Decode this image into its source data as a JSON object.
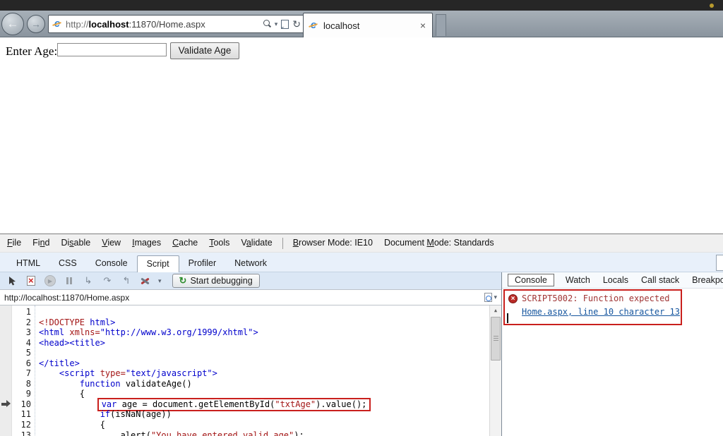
{
  "browser": {
    "address": {
      "scheme": "http://",
      "host": "localhost",
      "path": ":11870/Home.aspx"
    },
    "tab_title": "localhost",
    "tab_close": "×",
    "icons": {
      "back": "←",
      "forward": "→",
      "ie_logo": "e",
      "autocomplete_caret": "▾",
      "refresh": "↻",
      "tab_close": "×"
    }
  },
  "page": {
    "label": "Enter Age:",
    "input_value": "",
    "button": "Validate Age"
  },
  "devtools": {
    "menu": [
      {
        "label": "File",
        "u": 0
      },
      {
        "label": "Find",
        "u": 2
      },
      {
        "label": "Disable",
        "u": 2
      },
      {
        "label": "View",
        "u": 0
      },
      {
        "label": "Images",
        "u": 0
      },
      {
        "label": "Cache",
        "u": 0
      },
      {
        "label": "Tools",
        "u": 0
      },
      {
        "label": "Validate",
        "u": 1
      }
    ],
    "modes": [
      {
        "label": "Browser Mode: IE10",
        "u": 0
      },
      {
        "label": "Document Mode: Standards",
        "u": 9
      }
    ],
    "tabs": [
      {
        "label": "HTML"
      },
      {
        "label": "CSS"
      },
      {
        "label": "Console"
      },
      {
        "label": "Script",
        "active": true
      },
      {
        "label": "Profiler"
      },
      {
        "label": "Network"
      }
    ],
    "toolbar": {
      "icons": [
        "pointer",
        "break-on-error",
        "continue",
        "pause",
        "step-into",
        "step-over",
        "step-out",
        "debug-tools"
      ],
      "step_glyphs": {
        "step_into": "↳",
        "step_over": "↷",
        "step_out": "↰"
      },
      "play_glyph": "▶",
      "start_debugging": "Start debugging",
      "start_debugging_icon": "↻",
      "dropdown_caret": "▾"
    },
    "file_url": "http://localhost:11870/Home.aspx",
    "scrollbar_up_glyph": "▲",
    "right_tabs": [
      {
        "label": "Console",
        "active": true
      },
      {
        "label": "Watch"
      },
      {
        "label": "Locals"
      },
      {
        "label": "Call stack"
      },
      {
        "label": "Breakpoints"
      }
    ],
    "console_error": {
      "icon_glyph": "×",
      "message": "SCRIPT5002: Function expected",
      "location_link": "Home.aspx, line 10 character 13"
    },
    "code": {
      "lines": [
        {
          "n": 1,
          "segs": []
        },
        {
          "n": 2,
          "segs": [
            {
              "t": "<!DOCTYPE ",
              "c": "r"
            },
            {
              "t": "html>",
              "c": "b"
            }
          ]
        },
        {
          "n": 3,
          "segs": [
            {
              "t": "<html ",
              "c": "b"
            },
            {
              "t": "xmlns=",
              "c": "r"
            },
            {
              "t": "\"http://www.w3.org/1999/xhtml\">",
              "c": "b"
            }
          ]
        },
        {
          "n": 4,
          "segs": [
            {
              "t": "<head><title>",
              "c": "b"
            }
          ]
        },
        {
          "n": 5,
          "segs": []
        },
        {
          "n": 6,
          "segs": [
            {
              "t": "</title>",
              "c": "b"
            }
          ]
        },
        {
          "n": 7,
          "segs": [
            {
              "t": "    ",
              "c": "k"
            },
            {
              "t": "<script ",
              "c": "b"
            },
            {
              "t": "type=",
              "c": "r"
            },
            {
              "t": "\"text/javascript\">",
              "c": "b"
            }
          ]
        },
        {
          "n": 8,
          "segs": [
            {
              "t": "        ",
              "c": "k"
            },
            {
              "t": "function",
              "c": "b"
            },
            {
              "t": " validateAge()",
              "c": "k"
            }
          ]
        },
        {
          "n": 9,
          "segs": [
            {
              "t": "        {",
              "c": "k"
            }
          ]
        },
        {
          "n": 10,
          "arrow": true,
          "box_from": 1,
          "segs": [
            {
              "t": "            ",
              "c": "k"
            },
            {
              "t": "var",
              "c": "b"
            },
            {
              "t": " age = document.getElementById(",
              "c": "k"
            },
            {
              "t": "\"txtAge\"",
              "c": "r"
            },
            {
              "t": ").value();",
              "c": "k"
            }
          ]
        },
        {
          "n": 11,
          "segs": [
            {
              "t": "            ",
              "c": "k"
            },
            {
              "t": "if",
              "c": "b"
            },
            {
              "t": "(isNaN(age))",
              "c": "k"
            }
          ]
        },
        {
          "n": 12,
          "segs": [
            {
              "t": "            {",
              "c": "k"
            }
          ]
        },
        {
          "n": 13,
          "segs": [
            {
              "t": "                ",
              "c": "k"
            },
            {
              "t": "alert(",
              "c": "k"
            },
            {
              "t": "\"You have entered valid age\"",
              "c": "r"
            },
            {
              "t": ");",
              "c": "k"
            }
          ]
        }
      ]
    },
    "colors": {
      "code_keyword_blue": "#0000cc",
      "code_string_red": "#a31515",
      "error_text_red": "#a03535",
      "link_blue": "#15559e",
      "annotation_red": "#c9201d"
    }
  }
}
